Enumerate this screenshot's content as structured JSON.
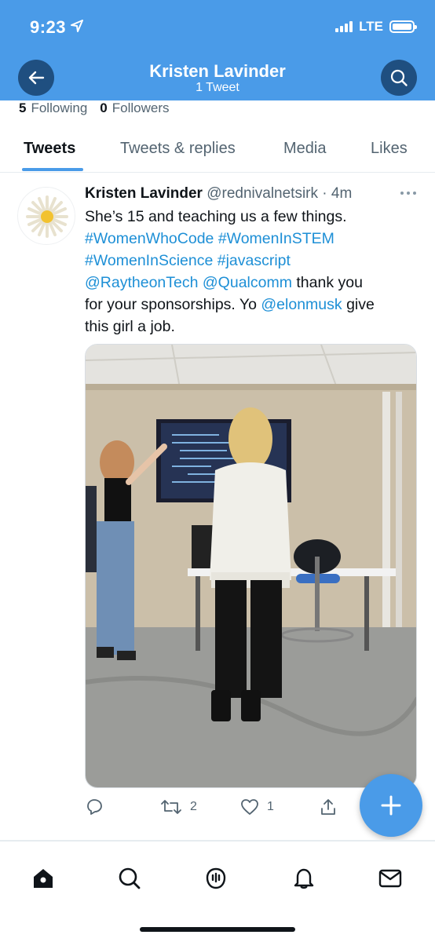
{
  "status_bar": {
    "time": "9:23",
    "network": "LTE"
  },
  "header": {
    "title": "Kristen Lavinder",
    "subtitle": "1 Tweet"
  },
  "profile": {
    "following_count": "5",
    "following_label": "Following",
    "followers_count": "0",
    "followers_label": "Followers"
  },
  "tabs": [
    {
      "label": "Tweets"
    },
    {
      "label": "Tweets & replies"
    },
    {
      "label": "Media"
    },
    {
      "label": "Likes"
    }
  ],
  "tweet": {
    "author_name": "Kristen Lavinder",
    "handle": "@rednivalnetsirk",
    "time": "4m",
    "text_line1": "She’s 15 and teaching us a few things.",
    "hashtag_women_who_code": "#WomenWhoCode",
    "hashtag_women_in_stem": "#WomenInSTEM",
    "hashtag_women_in_science": "#WomenInScience",
    "hashtag_javascript": "#javascript",
    "mention_raytheon": "@RaytheonTech",
    "mention_qualcomm": "@Qualcomm",
    "text_thank": " thank you",
    "text_sponsor": "for your sponsorships. Yo ",
    "mention_elon": "@elonmusk",
    "text_give": " give",
    "text_last": "this girl a job.",
    "retweet_count": "2",
    "like_count": "1"
  },
  "colors": {
    "brand": "#4a9be8",
    "link": "#1d8fd6",
    "header_button": "#1f4f80"
  },
  "icons": [
    "back-arrow-icon",
    "search-icon",
    "more-icon",
    "reply-icon",
    "retweet-icon",
    "like-icon",
    "share-icon",
    "compose-plus-icon",
    "home-icon",
    "explore-icon",
    "spaces-icon",
    "notifications-icon",
    "messages-icon"
  ]
}
